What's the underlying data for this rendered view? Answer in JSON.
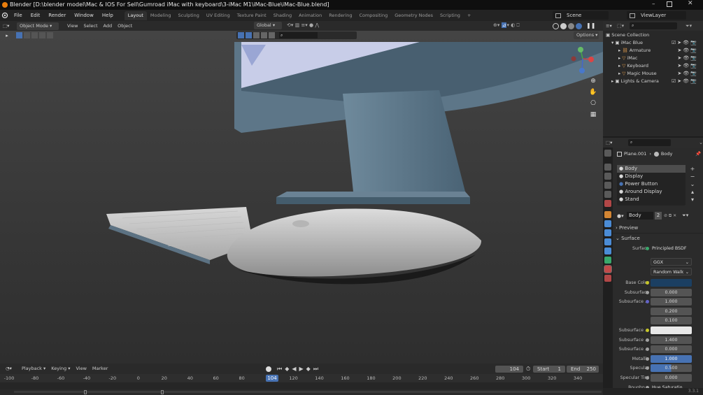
{
  "window": {
    "title": "Blender [D:\\blender model\\Mac & IOS For Sell\\Gumroad iMac with keyboard\\3-iMac M1\\iMac-Blue\\iMac-Blue.blend]"
  },
  "menu": [
    "File",
    "Edit",
    "Render",
    "Window",
    "Help"
  ],
  "workspaces": [
    "Layout",
    "Modeling",
    "Sculpting",
    "UV Editing",
    "Texture Paint",
    "Shading",
    "Animation",
    "Rendering",
    "Compositing",
    "Geometry Nodes",
    "Scripting"
  ],
  "active_workspace": "Layout",
  "scene": "Scene",
  "view_layer": "ViewLayer",
  "viewport": {
    "mode": "Object Mode",
    "menus": [
      "View",
      "Select",
      "Add",
      "Object"
    ],
    "transform": "Global",
    "options": "Options"
  },
  "outliner": {
    "root": "Scene Collection",
    "items": [
      {
        "label": "iMac Blue",
        "indent": 1
      },
      {
        "label": "Armature",
        "indent": 2
      },
      {
        "label": "iMac",
        "indent": 2
      },
      {
        "label": "Keyboard",
        "indent": 2
      },
      {
        "label": "Magic Mouse",
        "indent": 2
      },
      {
        "label": "Lights & Camera",
        "indent": 1
      }
    ]
  },
  "properties": {
    "breadcrumb_object": "Plane.001",
    "breadcrumb_material": "Body",
    "materials": [
      "Body",
      "Display",
      "Power Button",
      "Around Display",
      "Stand"
    ],
    "material_name": "Body",
    "material_users": "2",
    "section_preview": "Preview",
    "section_surface": "Surface",
    "surface_label": "Surface",
    "surface_value": "Principled BSDF",
    "distribution": "GGX",
    "subsurface_method": "Random Walk",
    "rows": [
      {
        "label": "Base Color",
        "value": "",
        "kind": "color",
        "color": "#1b3f62",
        "socket": "#c7c729"
      },
      {
        "label": "Subsurface",
        "value": "0.000",
        "kind": "num",
        "socket": "#a1a1a1"
      },
      {
        "label": "Subsurface ...",
        "value": "1.000",
        "kind": "num",
        "socket": "#6363c7"
      },
      {
        "label": "",
        "value": "0.200",
        "kind": "num",
        "socket": ""
      },
      {
        "label": "",
        "value": "0.100",
        "kind": "num",
        "socket": ""
      },
      {
        "label": "Subsurface ...",
        "value": "",
        "kind": "color",
        "color": "#e8e8e8",
        "socket": "#c7c729"
      },
      {
        "label": "Subsurface ...",
        "value": "1.400",
        "kind": "num",
        "socket": "#a1a1a1"
      },
      {
        "label": "Subsurface ...",
        "value": "0.000",
        "kind": "num",
        "socket": "#a1a1a1"
      },
      {
        "label": "Metallic",
        "value": "1.000",
        "kind": "blue",
        "socket": "#a1a1a1"
      },
      {
        "label": "Specular",
        "value": "0.500",
        "kind": "half",
        "socket": "#a1a1a1"
      },
      {
        "label": "Specular Tint",
        "value": "0.000",
        "kind": "num",
        "socket": "#a1a1a1"
      },
      {
        "label": "Roughn...",
        "value": "Hue Saturatio...",
        "kind": "link",
        "socket": "#a1a1a1"
      }
    ]
  },
  "timeline": {
    "menus": [
      "Playback",
      "Keying",
      "View",
      "Marker"
    ],
    "current_frame": "104",
    "start_label": "Start",
    "start": "1",
    "end_label": "End",
    "end": "250",
    "ticks": [
      "-100",
      "-80",
      "-60",
      "-40",
      "-20",
      "0",
      "20",
      "40",
      "60",
      "80",
      "120",
      "140",
      "160",
      "180",
      "200",
      "220",
      "240",
      "260",
      "280",
      "300",
      "320",
      "340"
    ],
    "playhead": "104"
  },
  "version": "3.3.1",
  "colors": {
    "accent": "#4772b3",
    "selection": "#334058",
    "playhead": "#4772b3"
  }
}
